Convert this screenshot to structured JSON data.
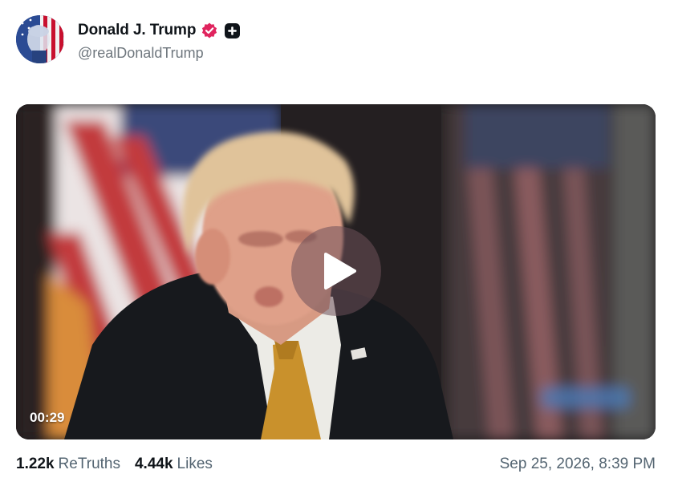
{
  "post": {
    "author": {
      "display_name": "Donald J. Trump",
      "handle": "@realDonaldTrump",
      "verified_badge_color": "#e0245e",
      "avatar_icon": "flag-portrait-avatar"
    },
    "media": {
      "type": "video",
      "duration": "00:29",
      "play_icon": "play-icon"
    },
    "stats": {
      "retruths_count": "1.22k",
      "retruths_label": "ReTruths",
      "likes_count": "4.44k",
      "likes_label": "Likes"
    },
    "timestamp": "Sep 25, 2026, 8:39 PM"
  },
  "colors": {
    "text_primary": "#0f1419",
    "text_secondary": "#536471",
    "badge_pink": "#e0245e"
  }
}
